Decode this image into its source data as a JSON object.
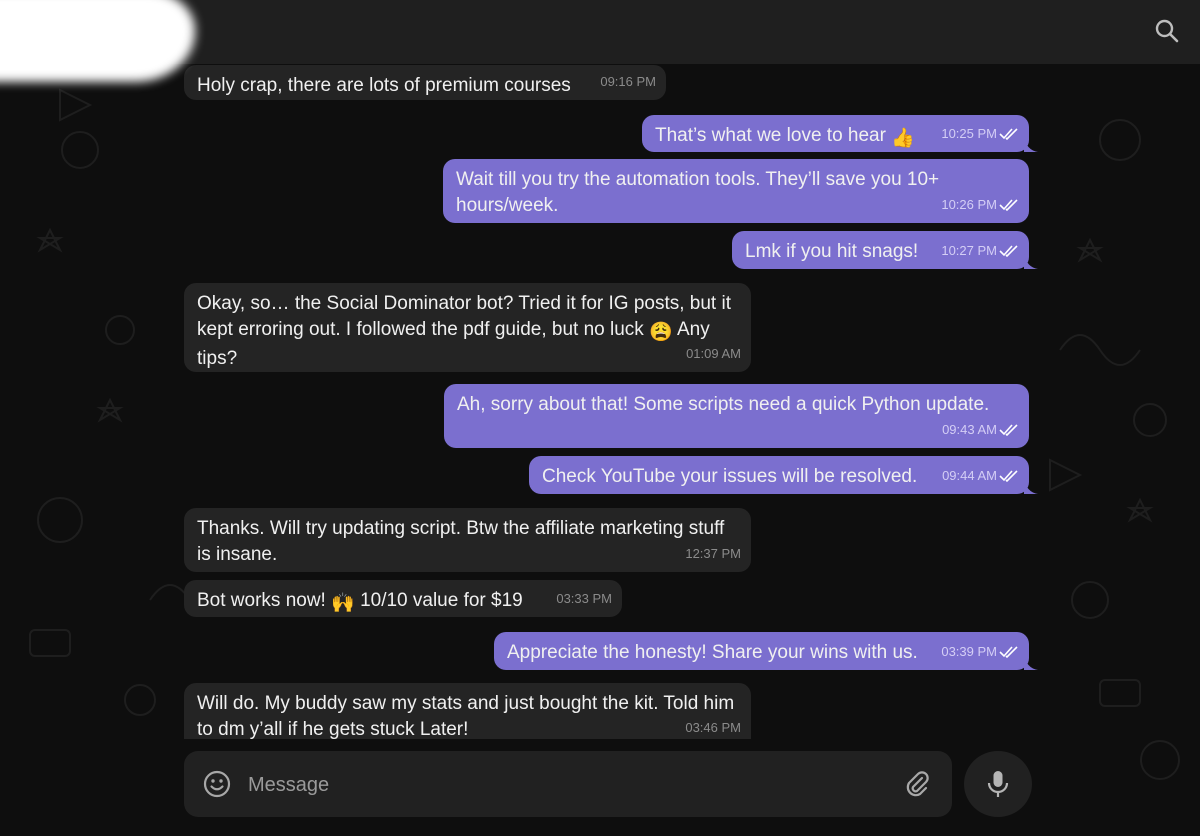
{
  "header": {
    "search_icon": "search-icon"
  },
  "messages": [
    {
      "dir": "in",
      "text": "Holy crap, there are lots of premium courses",
      "time": "09:16 PM"
    },
    {
      "dir": "out",
      "text": "That’s what we love to hear",
      "emoji": "👍",
      "time": "10:25 PM"
    },
    {
      "dir": "out",
      "text": "Wait till you try the automation tools. They’ll save you 10+ hours/week.",
      "time": "10:26 PM"
    },
    {
      "dir": "out",
      "text": "Lmk if you hit snags!",
      "time": "10:27 PM"
    },
    {
      "dir": "in",
      "text": "Okay, so… the Social Dominator bot? Tried it for IG posts, but it kept erroring out. I followed the pdf guide, but no luck",
      "emoji": "😩",
      "text_after": "Any tips?",
      "time": "01:09 AM"
    },
    {
      "dir": "out",
      "text": "Ah, sorry about that! Some scripts need a quick Python update.",
      "time": "09:43 AM"
    },
    {
      "dir": "out",
      "text": "Check YouTube your issues will be resolved.",
      "time": "09:44 AM"
    },
    {
      "dir": "in",
      "text": "Thanks. Will try updating script. Btw the affiliate marketing stuff is insane.",
      "time": "12:37 PM"
    },
    {
      "dir": "in",
      "text": "Bot works now!",
      "emoji": "🙌",
      "text_after": "10/10 value for $19",
      "time": "03:33 PM"
    },
    {
      "dir": "out",
      "text": "Appreciate the honesty! Share your wins with us.",
      "time": "03:39 PM"
    },
    {
      "dir": "in",
      "text": "Will do. My buddy saw my stats and just bought the kit. Told him to dm y’all if he gets stuck Later!",
      "time": "03:46 PM"
    }
  ],
  "composer": {
    "placeholder": "Message",
    "emoji_icon": "smiley-icon",
    "attach_icon": "paperclip-icon",
    "mic_icon": "microphone-icon"
  },
  "colors": {
    "outgoing_bubble": "#7b6fcf",
    "incoming_bubble": "#242424",
    "background": "#0e0e0e",
    "header": "#1f1f1f"
  }
}
